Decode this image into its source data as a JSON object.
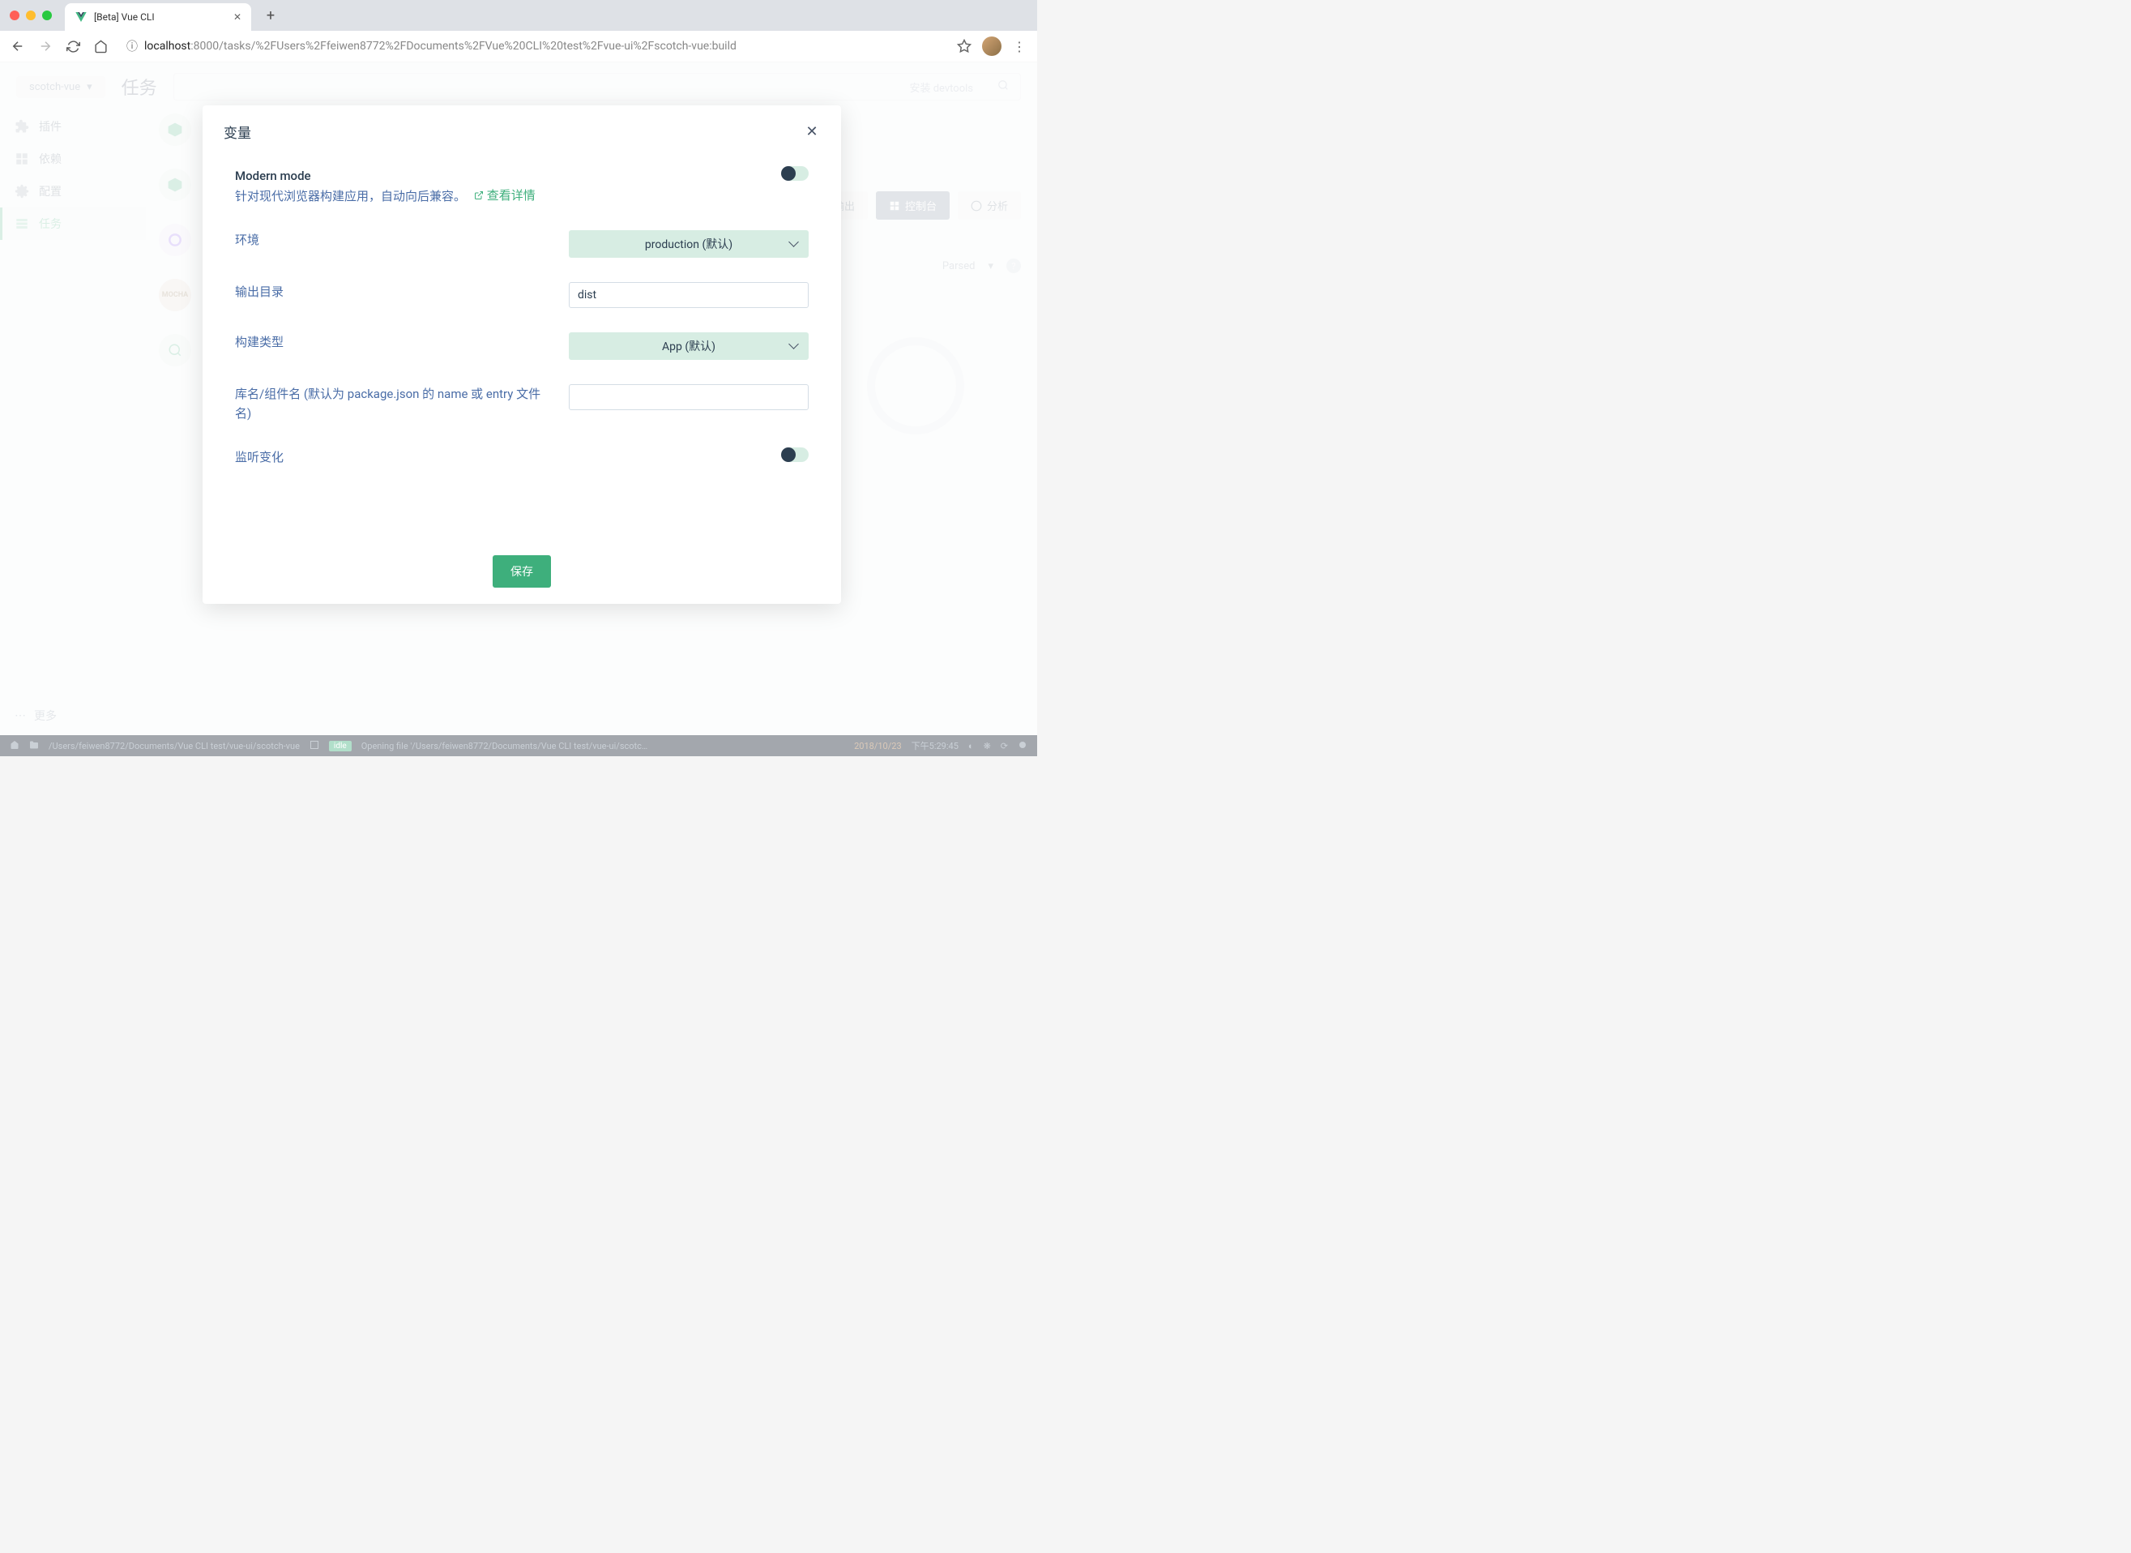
{
  "browser": {
    "tab_title": "[Beta] Vue CLI",
    "url_host": "localhost",
    "url_path": ":8000/tasks/%2FUsers%2Ffeiwen8772%2FDocuments%2FVue%20CLI%20test%2Fvue-ui%2Fscotch-vue:build"
  },
  "app": {
    "project_name": "scotch-vue",
    "page_title": "任务",
    "search_placeholder": "安装 devtools",
    "sidebar": {
      "plugins": "插件",
      "deps": "依赖",
      "config": "配置",
      "tasks": "任务",
      "more": "更多"
    },
    "panel": {
      "output": "输出",
      "console": "控制台",
      "analyze": "分析",
      "parsed": "Parsed"
    }
  },
  "statusbar": {
    "path": "/Users/feiwen8772/Documents/Vue CLI test/vue-ui/scotch-vue",
    "tag": "idle",
    "message": "Opening file '/Users/feiwen8772/Documents/Vue CLI test/vue-ui/scotc…",
    "date": "2018/10/23",
    "time": "下午5:29:45"
  },
  "modal": {
    "title": "变量",
    "modern_mode_title": "Modern mode",
    "modern_mode_desc": "针对现代浏览器构建应用，自动向后兼容。",
    "view_details": "查看详情",
    "env_label": "环境",
    "env_value": "production (默认)",
    "output_dir_label": "输出目录",
    "output_dir_value": "dist",
    "build_type_label": "构建类型",
    "build_type_value": "App (默认)",
    "lib_name_label": "库名/组件名 (默认为 package.json 的 name 或 entry 文件名)",
    "watch_label": "监听变化",
    "save_btn": "保存"
  }
}
